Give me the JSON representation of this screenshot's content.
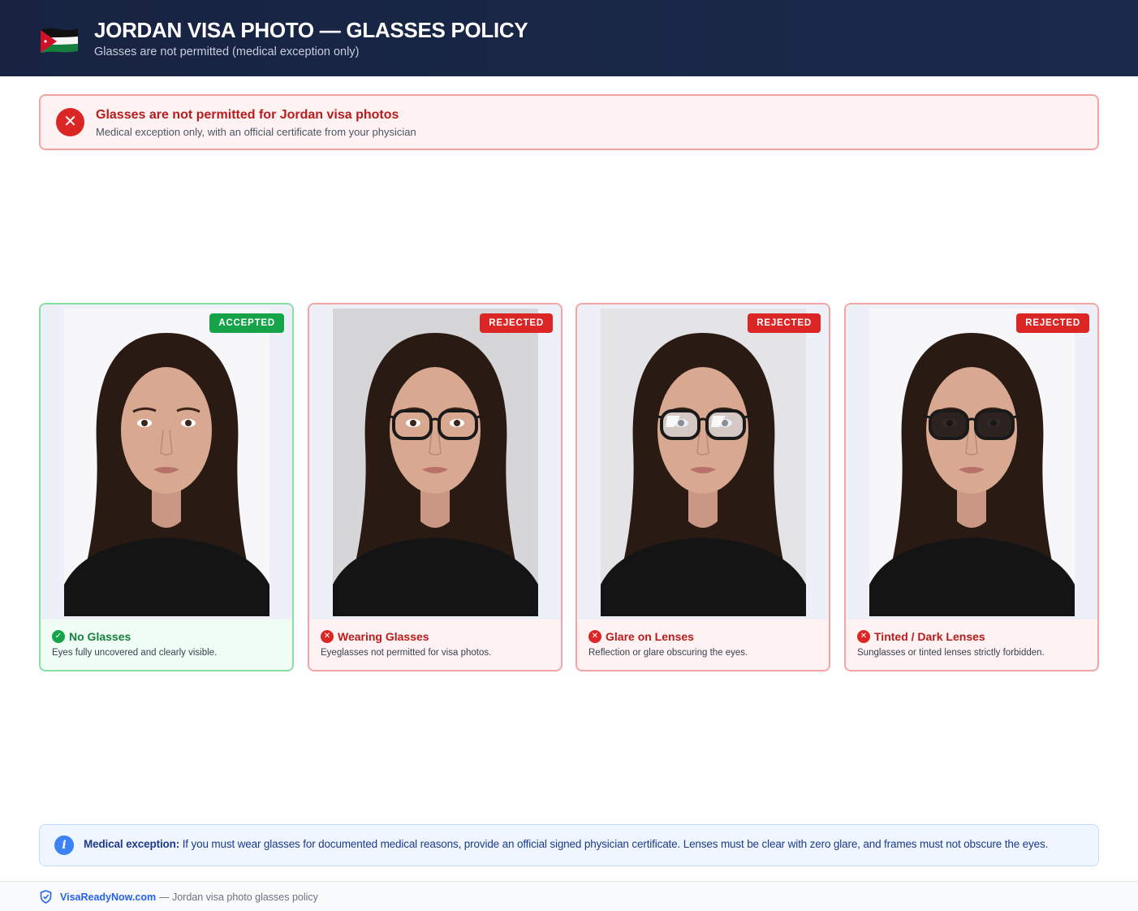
{
  "header": {
    "title": "JORDAN VISA PHOTO — GLASSES POLICY",
    "subtitle": "Glasses are not permitted (medical exception only)",
    "flag_icon": "jordan-flag-icon"
  },
  "alert": {
    "icon": "close-icon",
    "title": "Glasses are not permitted for Jordan visa photos",
    "subtitle": "Medical exception only, with an official certificate from your physician"
  },
  "cards": [
    {
      "status": "ACCEPTED",
      "title": "No Glasses",
      "desc": "Eyes fully uncovered and clearly visible.",
      "icon": "check-icon",
      "photo": "no-glasses"
    },
    {
      "status": "REJECTED",
      "title": "Wearing Glasses",
      "desc": "Eyeglasses not permitted for visa photos.",
      "icon": "close-icon",
      "photo": "wearing-glasses"
    },
    {
      "status": "REJECTED",
      "title": "Glare on Lenses",
      "desc": "Reflection or glare obscuring the eyes.",
      "icon": "close-icon",
      "photo": "glare-on-lenses"
    },
    {
      "status": "REJECTED",
      "title": "Tinted / Dark Lenses",
      "desc": "Sunglasses or tinted lenses strictly forbidden.",
      "icon": "close-icon",
      "photo": "tinted-lenses"
    }
  ],
  "info": {
    "icon": "info-icon",
    "label": "Medical exception:",
    "text": " If you must wear glasses for documented medical reasons, provide an official signed physician certificate. Lenses must be clear with zero glare, and frames must not obscure the eyes."
  },
  "footer": {
    "icon": "shield-check-icon",
    "brand": "VisaReadyNow.com",
    "text": "— Jordan visa photo glasses policy"
  },
  "colors": {
    "header_bg": "#172341",
    "accepted": "#16a34a",
    "rejected": "#dc2626",
    "info_blue": "#3b82f6",
    "brand_blue": "#2563eb"
  }
}
